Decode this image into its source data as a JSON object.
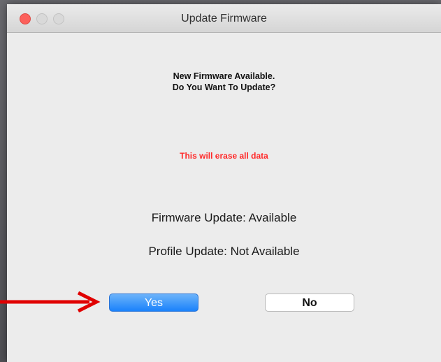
{
  "window": {
    "title": "Update Firmware"
  },
  "dialog": {
    "headline_line1": "New Firmware Available.",
    "headline_line2": "Do You Want To Update?",
    "warning": "This will erase all data",
    "firmware_status": "Firmware Update:  Available",
    "profile_status": "Profile Update:  Not Available",
    "yes_label": "Yes",
    "no_label": "No"
  },
  "colors": {
    "warning": "#ff2a2a",
    "primary_button": "#1a82fb",
    "arrow": "#e00000",
    "close_button": "#fc605b"
  },
  "icons": {
    "close": "close-icon",
    "minimize": "minimize-icon",
    "zoom": "zoom-icon",
    "annotation": "arrow-right-icon"
  }
}
